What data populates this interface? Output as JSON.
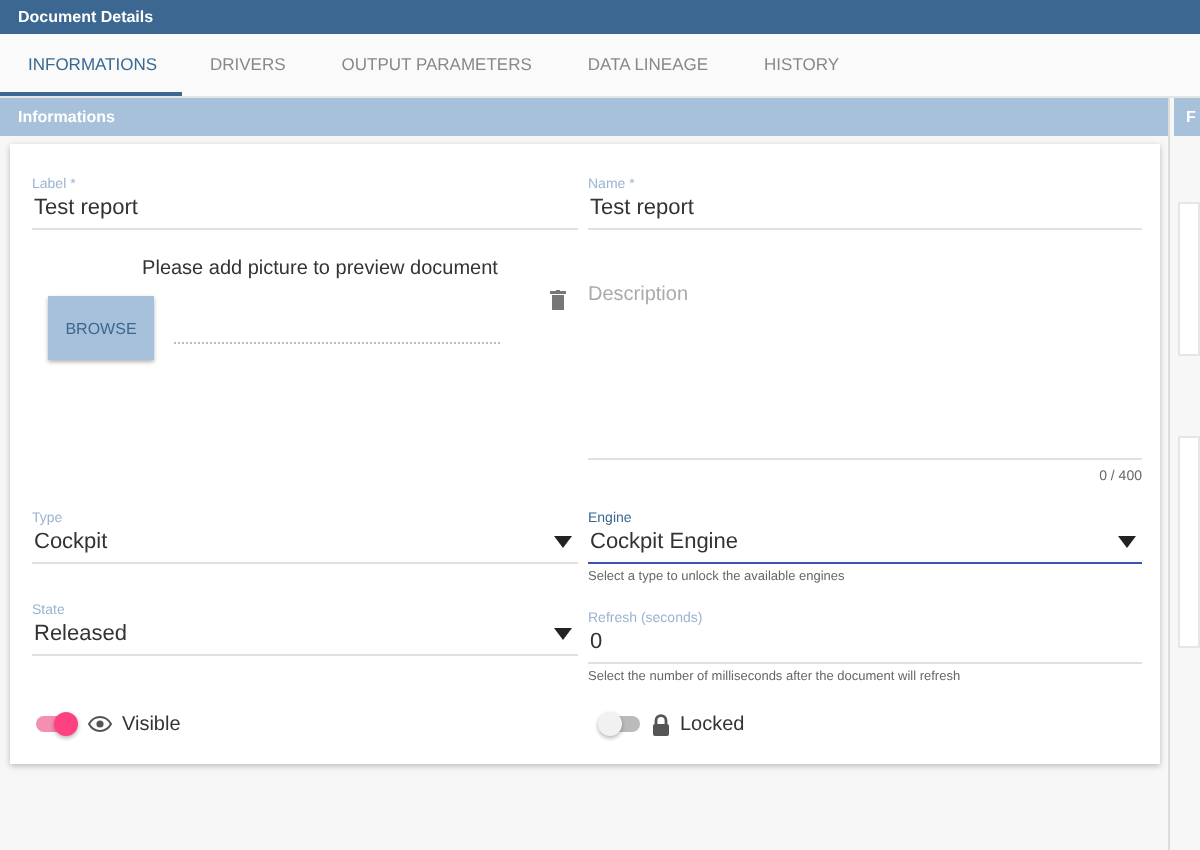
{
  "window": {
    "title": "Document Details"
  },
  "tabs": [
    {
      "label": "INFORMATIONS",
      "selected": true
    },
    {
      "label": "DRIVERS",
      "selected": false
    },
    {
      "label": "OUTPUT PARAMETERS",
      "selected": false
    },
    {
      "label": "DATA LINEAGE",
      "selected": false
    },
    {
      "label": "HISTORY",
      "selected": false
    }
  ],
  "section": {
    "title": "Informations"
  },
  "side_panel": {
    "title": "F"
  },
  "label_field": {
    "label": "Label *",
    "value": "Test report"
  },
  "name_field": {
    "label": "Name *",
    "value": "Test report"
  },
  "preview": {
    "message": "Please add picture to preview document",
    "button": "BROWSE"
  },
  "description": {
    "placeholder": "Description",
    "counter": "0 / 400"
  },
  "type_select": {
    "label": "Type",
    "value": "Cockpit",
    "focused": false
  },
  "engine_select": {
    "label": "Engine",
    "value": "Cockpit Engine",
    "hint": "Select a type to unlock the available engines",
    "focused": true
  },
  "state_select": {
    "label": "State",
    "value": "Released",
    "focused": false
  },
  "refresh_field": {
    "label": "Refresh (seconds)",
    "value": "0",
    "hint": "Select the number of milliseconds after the document will refresh"
  },
  "toggles": [
    {
      "kind": "eye",
      "label": "Visible",
      "on": true
    },
    {
      "kind": "lock",
      "label": "Locked",
      "on": false
    }
  ]
}
